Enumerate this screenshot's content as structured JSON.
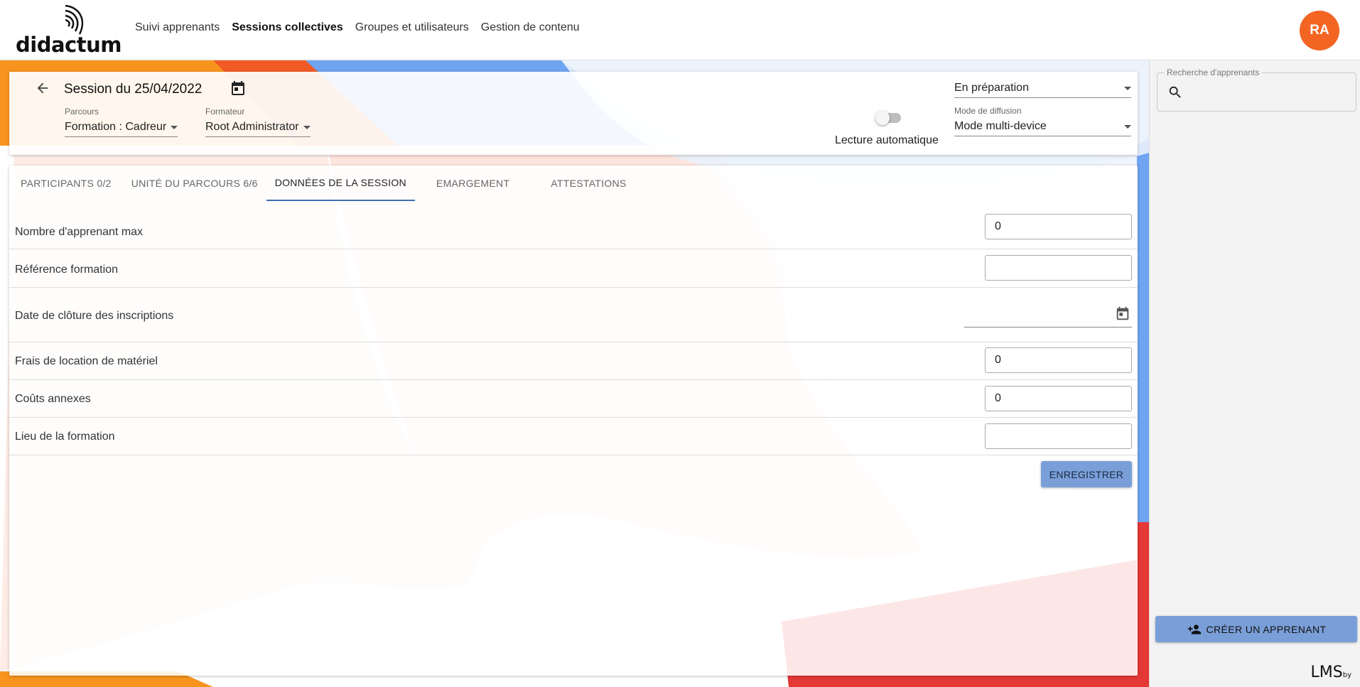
{
  "app": {
    "logo_text": "didactum",
    "avatar_initials": "RA",
    "brand_accent": "#f26522"
  },
  "nav": {
    "items": [
      {
        "label": "Suivi apprenants",
        "active": false
      },
      {
        "label": "Sessions collectives",
        "active": true
      },
      {
        "label": "Groupes et utilisateurs",
        "active": false
      },
      {
        "label": "Gestion de contenu",
        "active": false
      }
    ]
  },
  "header": {
    "title": "Session du 25/04/2022",
    "parcours": {
      "label": "Parcours",
      "value": "Formation : Cadreur"
    },
    "formateur": {
      "label": "Formateur",
      "value": "Root Administrator"
    },
    "auto_play": {
      "label": "Lecture automatique",
      "enabled": false
    },
    "status": {
      "value": "En préparation"
    },
    "mode": {
      "label": "Mode de diffusion",
      "value": "Mode multi-device"
    }
  },
  "tabs": [
    {
      "label": "PARTICIPANTS 0/2",
      "active": false
    },
    {
      "label": "UNITÉ DU PARCOURS 6/6",
      "active": false
    },
    {
      "label": "DONNÉES DE LA SESSION",
      "active": true
    },
    {
      "label": "EMARGEMENT",
      "active": false
    },
    {
      "label": "ATTESTATIONS",
      "active": false
    }
  ],
  "form": {
    "rows": [
      {
        "label": "Nombre d'apprenant max",
        "value": "0"
      },
      {
        "label": "Référence formation",
        "value": ""
      },
      {
        "label": "Date de clôture des inscriptions",
        "value": ""
      },
      {
        "label": "Frais de location de matériel",
        "value": "0"
      },
      {
        "label": "Coûts annexes",
        "value": "0"
      },
      {
        "label": "Lieu de la formation",
        "value": ""
      }
    ],
    "save_label": "ENREGISTRER"
  },
  "sidebar": {
    "search_label": "Recherche d'apprenants",
    "search_value": "",
    "create_label": "CRÉER UN APPRENANT",
    "footer": "LMS",
    "footer_small": "by"
  },
  "colors": {
    "button": "#7a9fd8",
    "tab_indicator": "#3f6fb5",
    "orange": "#f7941d",
    "red": "#e53935",
    "blue": "#6fa4f0"
  }
}
